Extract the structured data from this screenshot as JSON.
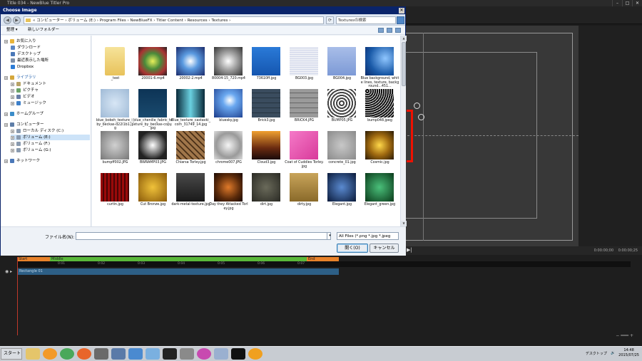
{
  "app": {
    "title": "Title 034 - NewBlue Titler Pro",
    "timecode_1": "0:00:00;00",
    "timecode_2": "0:00:00;25"
  },
  "dialog": {
    "title": "Choose Image",
    "breadcrumb": "« コンピューター › ボリューム (E:) › Program Files › NewBlueFX › Titler Content › Resources › Textures ›",
    "search_placeholder": "Texturesの検索",
    "organize_label": "整理 ▾",
    "new_folder_label": "新しいフォルダー",
    "filename_label": "ファイル名(N):",
    "filename_value": "",
    "filetype_value": "All Files (*.png *.jpg *.jpeg",
    "open_label": "開く(O)",
    "cancel_label": "キャンセル"
  },
  "nav": [
    {
      "label": "お気に入り",
      "kind": "header",
      "color": "#e8b43a"
    },
    {
      "label": "ダウンロード",
      "kind": "item",
      "color": "#5a86c4"
    },
    {
      "label": "デスクトップ",
      "kind": "item",
      "color": "#4a78b8"
    },
    {
      "label": "最近表示した場所",
      "kind": "item",
      "color": "#7d8fa8"
    },
    {
      "label": "Dropbox",
      "kind": "item",
      "color": "#2d7cd6"
    },
    {
      "label": "ライブラリ",
      "kind": "header",
      "color": "#d4a73c"
    },
    {
      "label": "ドキュメント",
      "kind": "item",
      "color": "#b8a368"
    },
    {
      "label": "ピクチャ",
      "kind": "item",
      "color": "#6ba368"
    },
    {
      "label": "ビデオ",
      "kind": "item",
      "color": "#6a7fa8"
    },
    {
      "label": "ミュージック",
      "kind": "item",
      "color": "#3d7fc9"
    },
    {
      "label": "ホームグループ",
      "kind": "header",
      "color": "#3a8cc9"
    },
    {
      "label": "コンピューター",
      "kind": "header",
      "color": "#5e7ea8"
    },
    {
      "label": "ローカル ディスク (C:)",
      "kind": "item",
      "color": "#8a9bb0"
    },
    {
      "label": "ボリューム (E:)",
      "kind": "item",
      "color": "#8a9bb0",
      "selected": true
    },
    {
      "label": "ボリューム (F:)",
      "kind": "item",
      "color": "#8a9bb0"
    },
    {
      "label": "ボリューム (G:)",
      "kind": "item",
      "color": "#8a9bb0"
    },
    {
      "label": "ネットワーク",
      "kind": "header",
      "color": "#4a78b8"
    }
  ],
  "files": [
    {
      "name": "_test",
      "bg": "linear-gradient(#f6e39a,#e8c25a)"
    },
    {
      "name": "20001-6.mp4",
      "bg": "radial-gradient(circle,#e8f05a,#4a8a3a 40%,#a33 70%,#222)"
    },
    {
      "name": "20002-2.mp4",
      "bg": "radial-gradient(circle,#fff,#5a9ae0 40%,#1a2a6a)"
    },
    {
      "name": "80004-15_720.mp4",
      "bg": "radial-gradient(circle,#fff,#aaa 40%,#333)"
    },
    {
      "name": "73610ff.jpg",
      "bg": "linear-gradient(#2a7ad8,#1556b0)"
    },
    {
      "name": "BG003.jpg",
      "bg": "repeating-linear-gradient(0deg,#eceef5 0 2px,#d2d8ea 2px 3px)"
    },
    {
      "name": "BG004.jpg",
      "bg": "linear-gradient(#a8bde8,#7d9ad6)"
    },
    {
      "name": "Blue background, white lines, texture, background...451...",
      "bg": "radial-gradient(circle at 70% 40%,#8fc6ff,#1a5aa8 60%,#0a2a6a)"
    },
    {
      "name": "blue_bokeh_texture_i_by_beckas-d22l1b1.jpg",
      "bg": "radial-gradient(circle,#d7e6f5,#9fbad6)"
    },
    {
      "name": "blue_chenille_fabric_texture_by_beckas-copy.jpg",
      "bg": "linear-gradient(#0d3456,#1a4a6e)"
    },
    {
      "name": "Blue_texture_castavki_com_31749_14.jpg",
      "bg": "linear-gradient(90deg,#0a2a3a,#6ad0e0 50%,#0a2a3a)"
    },
    {
      "name": "bluesky.jpg",
      "bg": "radial-gradient(circle at 55% 40%,#fff,#6aa8f0 30%,#1a3a8a)"
    },
    {
      "name": "Brick3.jpg",
      "bg": "repeating-linear-gradient(0deg,#3a4c5e 0 6px,#263440 6px 7px)"
    },
    {
      "name": "BRICK4.JPG",
      "bg": "repeating-linear-gradient(0deg,#9a9a9a 0 6px,#666 6px 7px)"
    },
    {
      "name": "BUMP05.JPG",
      "bg": "repeating-radial-gradient(circle,#fff 0 2px,#444 2px 4px)"
    },
    {
      "name": "bump048.jpeg",
      "bg": "repeating-radial-gradient(circle at 3px 3px,#ddd 0 1px,#111 1px 3px)"
    },
    {
      "name": "bumpff002.JPG",
      "bg": "radial-gradient(circle,#d0d0d0,#777)"
    },
    {
      "name": "BWRAMP03.JPG",
      "bg": "radial-gradient(circle,#fff,#222 70%)"
    },
    {
      "name": "Chiarsa Torley.jpg",
      "bg": "repeating-linear-gradient(45deg,#a0764a 0 4px,#4a3018 4px 6px)"
    },
    {
      "name": "chrome007.JPG",
      "bg": "radial-gradient(circle,#f5f5f5,#9a9a9a 60%,#ddd)"
    },
    {
      "name": "Cloud3.jpg",
      "bg": "linear-gradient(#f0a030,#6a2a10 60%,#1a0a0a)"
    },
    {
      "name": "Coat of Cuddles Torley.jpg",
      "bg": "linear-gradient(135deg,#f57ac8,#d83a9a)"
    },
    {
      "name": "concrete_01.jpg",
      "bg": "radial-gradient(circle,#c8c8c8,#8a8a8a)"
    },
    {
      "name": "Cosmic.jpg",
      "bg": "radial-gradient(circle,#ffd84a,#a06a10 50%,#2a1a04)"
    },
    {
      "name": "curtin.jpg",
      "bg": "repeating-linear-gradient(90deg,#9a0a0a 0 3px,#4a0505 3px 5px)"
    },
    {
      "name": "Cut Bronze.jpg",
      "bg": "radial-gradient(circle,#f0c23a,#8a5a0a)"
    },
    {
      "name": "dark-metal-texture.jpg",
      "bg": "linear-gradient(#4a4a4a,#1a1a1a)"
    },
    {
      "name": "Day they Attacked Torley.jpg",
      "bg": "radial-gradient(circle,#e07a2a,#5a2a0a 60%,#1a0a04)"
    },
    {
      "name": "dirt.jpg",
      "bg": "radial-gradient(circle,#6a6a5a,#2a2a24)"
    },
    {
      "name": "dirty.jpg",
      "bg": "linear-gradient(#c8a45a,#8a6a2a)"
    },
    {
      "name": "Elegant.jpg",
      "bg": "radial-gradient(circle,#5a8ad0,#0a1a3a)"
    },
    {
      "name": "Elegant_green.jpg",
      "bg": "radial-gradient(circle,#4ac07a,#0a3a1a)"
    }
  ],
  "timeline": {
    "markers": [
      {
        "label": "Start",
        "color": "#e8822a"
      },
      {
        "label": "Middle",
        "color": "#5ab83a"
      },
      {
        "label": "End",
        "color": "#e8822a"
      }
    ],
    "ruler": [
      "0:01",
      "0:02",
      "0:03",
      "0:04",
      "0:05",
      "0:06",
      "0:07"
    ],
    "track_label": "Rectangle 01"
  },
  "taskbar": {
    "start_label": "スタート",
    "tray_text": "デスクトップ",
    "time": "14:48",
    "date": "2015/07/25"
  }
}
